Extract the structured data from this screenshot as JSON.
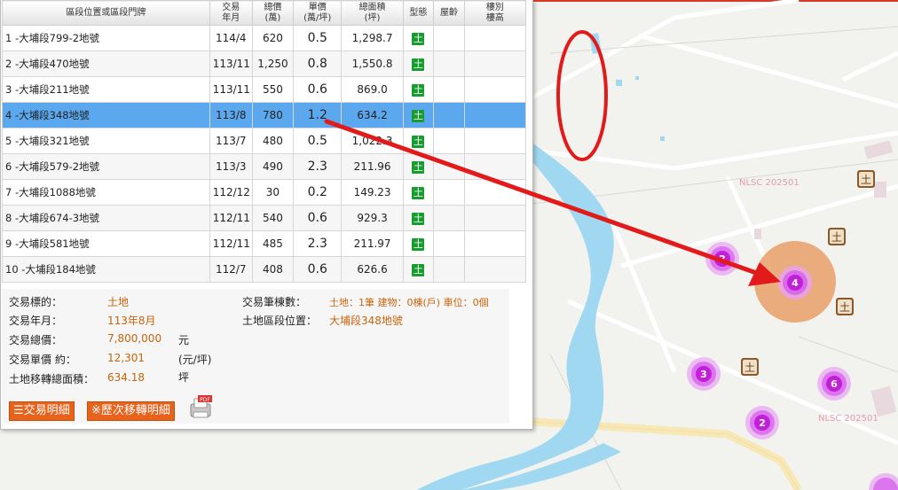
{
  "table": {
    "headers": {
      "address": "區段位置或區段門牌",
      "date_l1": "交易",
      "date_l2": "年月",
      "total_l1": "總價",
      "total_l2": "(萬)",
      "unit_l1": "單價",
      "unit_l2": "(萬/坪)",
      "area_l1": "總面積",
      "area_l2": "(坪)",
      "type": "型態",
      "age": "屋齡",
      "floor_l1": "樓別",
      "floor_l2": "樓高"
    },
    "rows": [
      {
        "addr": "1 -大埔段799-2地號",
        "date": "114/4",
        "total": "620",
        "unit": "0.5",
        "area": "1,298.7",
        "type": "土"
      },
      {
        "addr": "2 -大埔段470地號",
        "date": "113/11",
        "total": "1,250",
        "unit": "0.8",
        "area": "1,550.8",
        "type": "土"
      },
      {
        "addr": "3 -大埔段211地號",
        "date": "113/11",
        "total": "550",
        "unit": "0.6",
        "area": "869.0",
        "type": "土"
      },
      {
        "addr": "4 -大埔段348地號",
        "date": "113/8",
        "total": "780",
        "unit": "1.2",
        "area": "634.2",
        "type": "土"
      },
      {
        "addr": "5 -大埔段321地號",
        "date": "113/7",
        "total": "480",
        "unit": "0.5",
        "area": "1,022.3",
        "type": "土"
      },
      {
        "addr": "6 -大埔段579-2地號",
        "date": "113/3",
        "total": "490",
        "unit": "2.3",
        "area": "211.96",
        "type": "土"
      },
      {
        "addr": "7 -大埔段1088地號",
        "date": "112/12",
        "total": "30",
        "unit": "0.2",
        "area": "149.23",
        "type": "土"
      },
      {
        "addr": "8 -大埔段674-3地號",
        "date": "112/11",
        "total": "540",
        "unit": "0.6",
        "area": "929.3",
        "type": "土"
      },
      {
        "addr": "9 -大埔段581地號",
        "date": "112/11",
        "total": "485",
        "unit": "2.3",
        "area": "211.97",
        "type": "土"
      },
      {
        "addr": "10 -大埔段184地號",
        "date": "112/7",
        "total": "408",
        "unit": "0.6",
        "area": "626.6",
        "type": "土"
      }
    ],
    "selected_row": 4
  },
  "detail": {
    "target_label": "交易標的：",
    "target_value": "土地",
    "date_label": "交易年月：",
    "date_value": "113年8月",
    "total_label": "交易總價：",
    "total_value": "7,800,000",
    "total_unit": "元",
    "unit_label": "交易單價 約：",
    "unit_value": "12,301",
    "unit_unit": "(元/坪)",
    "area_label": "土地移轉總面積：",
    "area_value": "634.18",
    "area_unit": "坪",
    "count_label": "交易筆棟數：",
    "count_value": "土地：1筆 建物：0棟(戶) 車位：0個",
    "location_label": "土地區段位置：",
    "location_value": "大埔段348地號"
  },
  "buttons": {
    "detail": "☰交易明細",
    "history": "※歷次移轉明細",
    "pdf": "PDF"
  },
  "map": {
    "watermarks": [
      "NLSC 202501",
      "NLSC 202501"
    ],
    "land_marker": "土",
    "clusters": [
      "2",
      "4",
      "3",
      "6",
      "2"
    ]
  },
  "colors": {
    "selected_row": "#5ca8ef",
    "value_text": "#c8640a",
    "button": "#e9621c",
    "land_badge": "#189c2f",
    "cluster": "#c21fd8",
    "arrow": "#e21a1a",
    "river": "#9fd8f0"
  }
}
